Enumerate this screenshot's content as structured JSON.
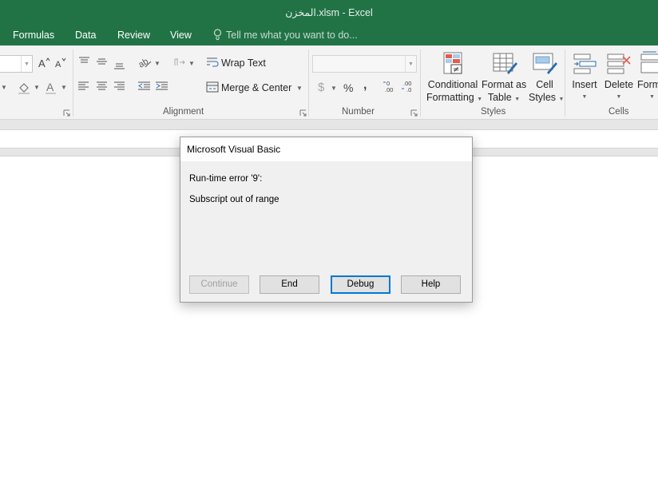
{
  "window": {
    "title": "المخزن.xlsm - Excel"
  },
  "menu": {
    "tabs": [
      "Formulas",
      "Data",
      "Review",
      "View"
    ],
    "tell_me": "Tell me what you want to do..."
  },
  "ribbon": {
    "alignment": {
      "label": "Alignment",
      "wrap_text": "Wrap Text",
      "merge_center": "Merge & Center"
    },
    "number": {
      "label": "Number",
      "currency_symbol": "$",
      "percent_symbol": "%",
      "comma_symbol": ","
    },
    "styles": {
      "label": "Styles",
      "conditional_formatting": [
        "Conditional",
        "Formatting"
      ],
      "format_as_table": [
        "Format as",
        "Table"
      ],
      "cell_styles": [
        "Cell",
        "Styles"
      ]
    },
    "cells": {
      "label": "Cells",
      "insert": "Insert",
      "delete": "Delete",
      "format": "Form"
    }
  },
  "dialog": {
    "title": "Microsoft Visual Basic",
    "error_line": "Run-time error '9':",
    "message": "Subscript out of range",
    "buttons": {
      "continue": "Continue",
      "end": "End",
      "debug": "Debug",
      "help": "Help"
    }
  },
  "colors": {
    "excel_green": "#217346",
    "dialog_bg": "#f0f0f0",
    "focus_blue": "#0078d7"
  }
}
